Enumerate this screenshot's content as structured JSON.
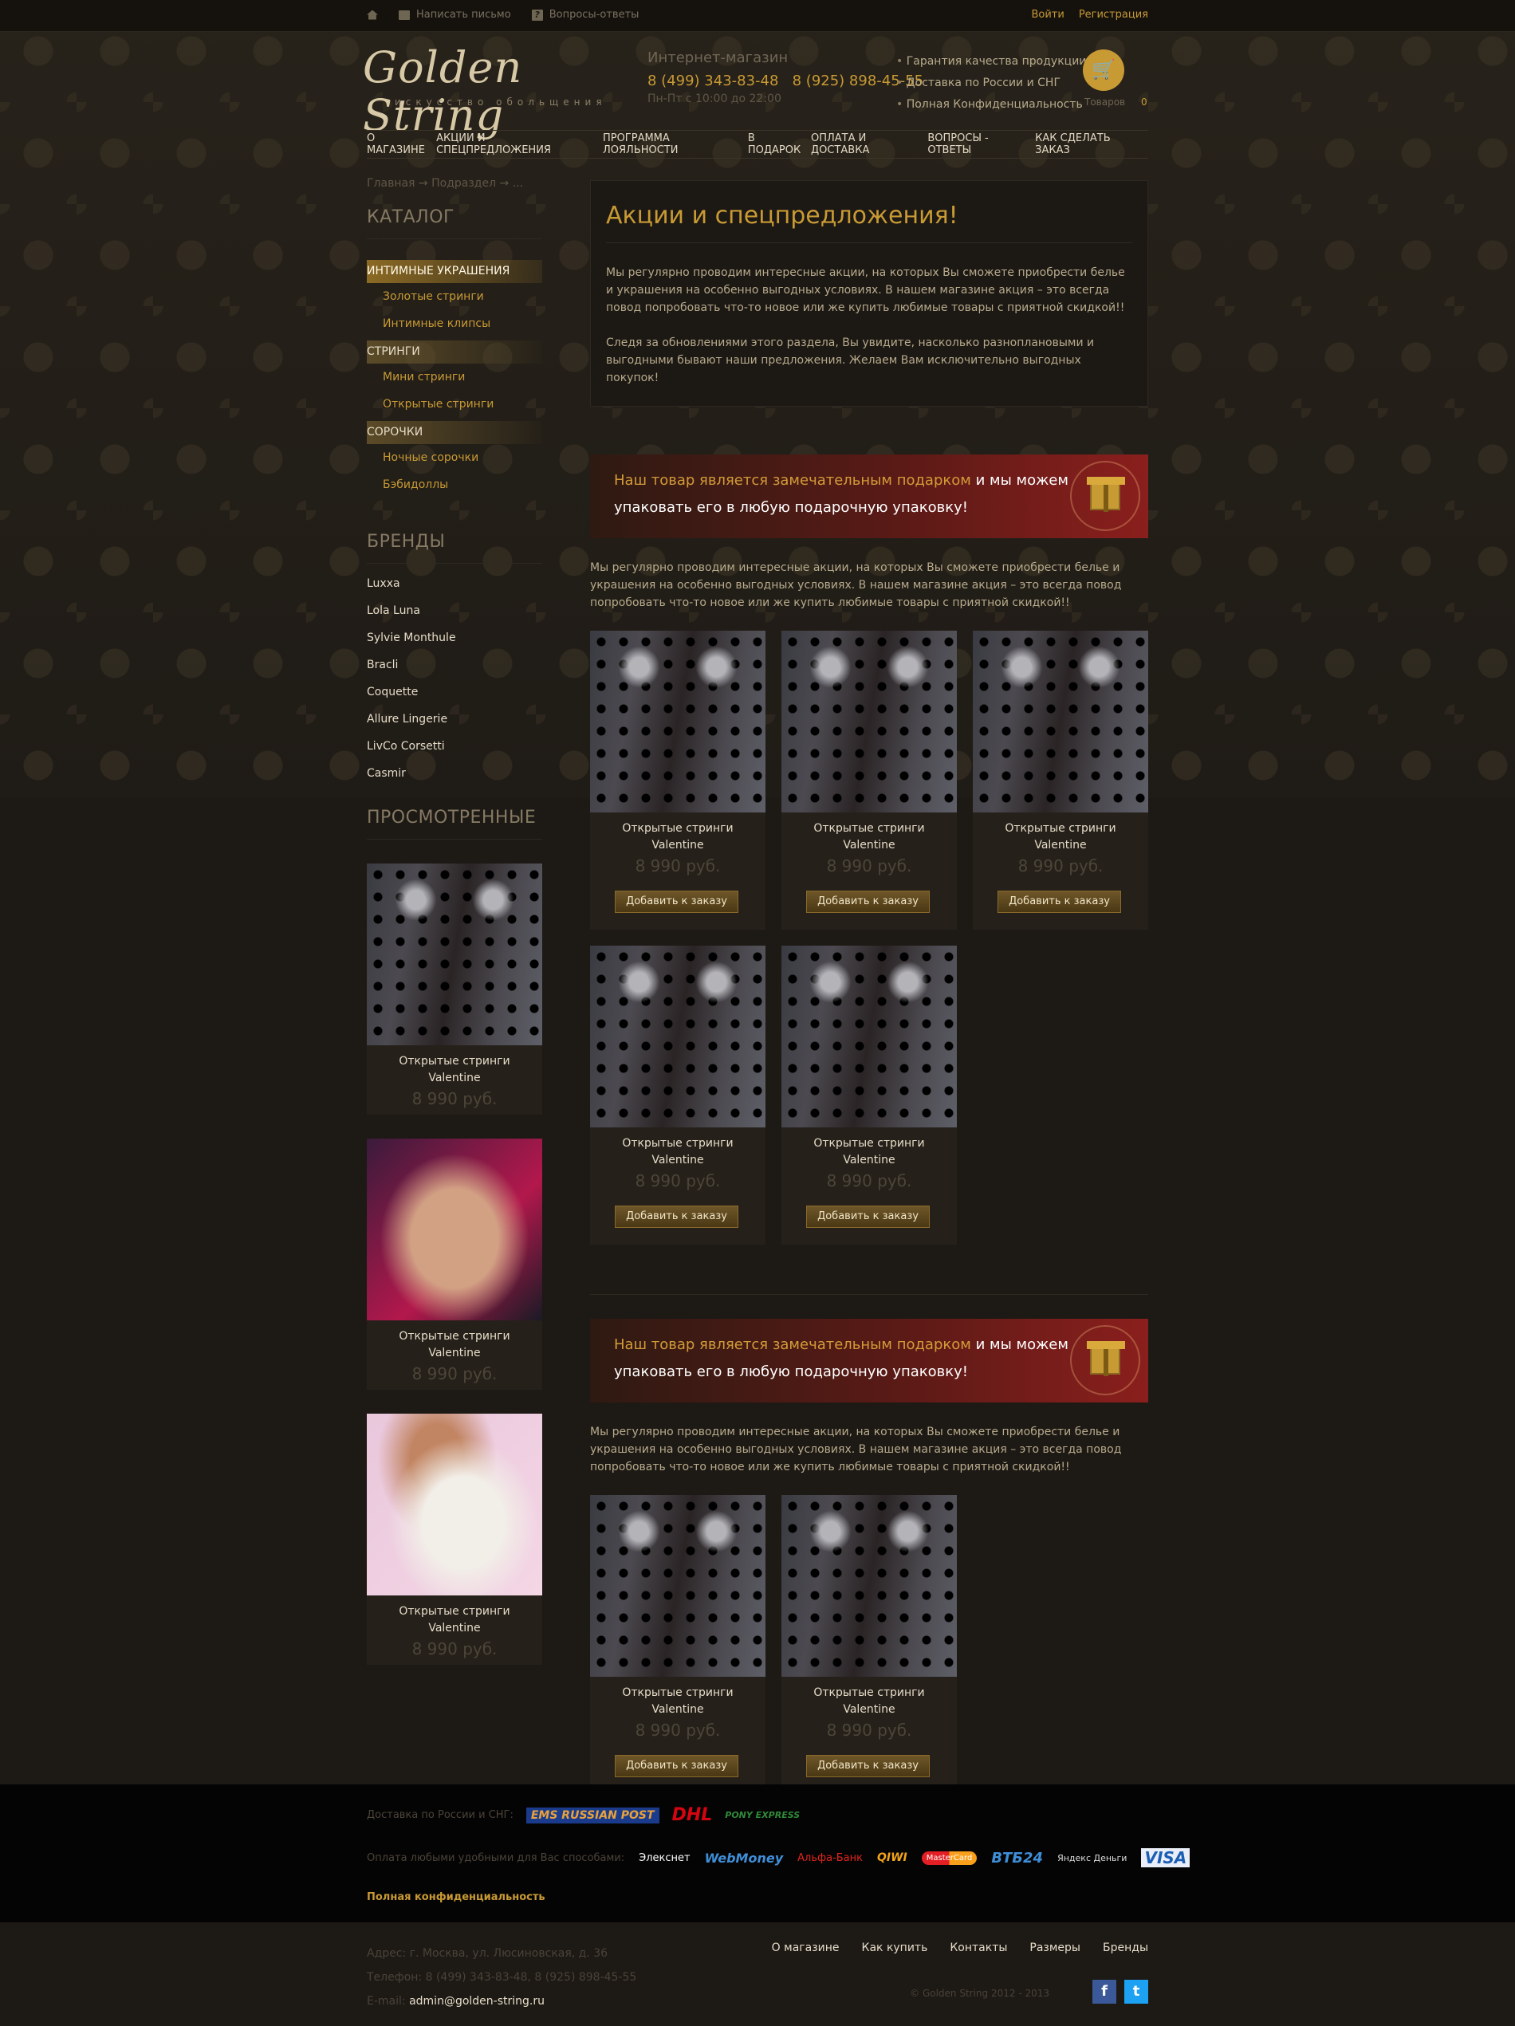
{
  "topbar": {
    "home": "",
    "write": "Написать письмо",
    "faq": "Вопросы-ответы",
    "login": "Войти",
    "register": "Регистрация"
  },
  "logo": {
    "title": "Golden String",
    "tagline": "искусство обольщения"
  },
  "shop": {
    "label": "Интернет-магазин",
    "phones": "8 (499) 343-83-48   8 (925) 898-45-55",
    "hours": "Пн-Пт с 10:00 до 22:00"
  },
  "features": [
    "Гарантия качества продукции",
    "Доставка по России и СНГ",
    "Полная Конфиденциальность"
  ],
  "cart": {
    "label": "Товаров",
    "count": "0",
    "icon": "cart-icon"
  },
  "nav": [
    "О магазине",
    "Акции и спецпредложения",
    "Программа лояльности",
    "В подарок",
    "Оплата и доставка",
    "Вопросы - ответы",
    "Как сделать заказ"
  ],
  "breadcrumb": "Главная → Подраздел → ...",
  "catalog": {
    "title": "Каталог",
    "groups": [
      {
        "name": "Интимные украшения",
        "items": [
          "Золотые стринги",
          "Интимные клипсы"
        ]
      },
      {
        "name": "Стринги",
        "items": [
          "Мини стринги",
          "Открытые стринги"
        ]
      },
      {
        "name": "Сорочки",
        "items": [
          "Ночные сорочки",
          "Бэбидоллы"
        ]
      }
    ]
  },
  "brands": {
    "title": "Бренды",
    "items": [
      "Luxxa",
      "Lola Luna",
      "Sylvie Monthule",
      "Bracli",
      "Coquette",
      "Allure Lingerie",
      "LivCo Corsetti",
      "Casmir"
    ]
  },
  "viewed": {
    "title": "Просмотренные",
    "items": [
      {
        "name1": "Открытые стринги",
        "name2": "Valentine",
        "price": "8 990 руб."
      },
      {
        "name1": "Открытые стринги",
        "name2": "Valentine",
        "price": "8 990 руб."
      },
      {
        "name1": "Открытые стринги",
        "name2": "Valentine",
        "price": "8 990 руб."
      }
    ]
  },
  "intro": {
    "title": "Акции и спецпредложения!",
    "p1": "Мы регулярно проводим интересные акции, на которых Вы сможете приобрести белье и украшения на особенно выгодных условиях. В нашем магазине акция – это всегда повод попробовать что-то новое или же купить любимые товары с приятной скидкой!!",
    "p2": "Следя за обновлениями этого раздела, Вы увидите, насколько разноплановыми и выгодными бывают наши предложения. Желаем Вам исключительно выгодных покупок!"
  },
  "banner": {
    "highlight": "Наш товар является замечательным подарком",
    "rest": " и мы можем",
    "line2": "упаковать его в любую подарочную упаковку!"
  },
  "promo_text": "Мы регулярно проводим интересные акции, на которых Вы сможете приобрести белье и украшения на особенно выгодных условиях. В нашем магазине акция – это всегда повод попробовать что-то новое или же купить любимые товары с приятной скидкой!!",
  "product": {
    "name1": "Открытые стринги",
    "name2": "Valentine",
    "price": "8 990 руб.",
    "button": "Добавить к заказу"
  },
  "footer": {
    "delivery_label": "Доставка по России и СНГ:",
    "payment_label": "Оплата любыми удобными для Вас способами:",
    "couriers": [
      "EMS RUSSIAN POST",
      "DHL",
      "PONY EXPRESS"
    ],
    "payments": [
      "Элекснет",
      "WebMoney",
      "Альфа-Банк",
      "QIWI",
      "MasterCard",
      "ВТБ24",
      "Яндекс Деньги",
      "VISA"
    ],
    "privacy": "Полная конфиденциальность",
    "address": "Адрес: г. Москва, ул. Люсиновская, д. 36",
    "phone_label": "Телефон:",
    "phone": "8 (499) 343-83-48, 8 (925) 898-45-55",
    "email_label": "E-mail:",
    "email": "admin@golden-string.ru",
    "menu": [
      "О магазине",
      "Как купить",
      "Контакты",
      "Размеры",
      "Бренды"
    ],
    "copyright": "© Golden String  2012 - 2013"
  }
}
